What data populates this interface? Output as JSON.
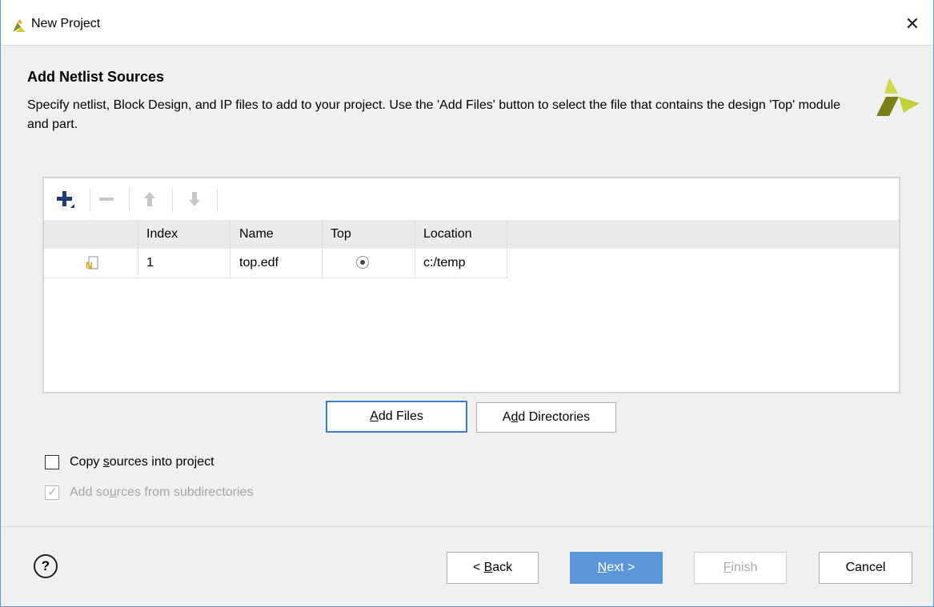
{
  "window": {
    "title": "New Project"
  },
  "page": {
    "title": "Add Netlist Sources",
    "description": "Specify netlist, Block Design, and IP files to add to your project. Use the 'Add Files' button to select the file that contains the design 'Top' module and part."
  },
  "toolbar": {
    "add": "add-icon",
    "remove": "remove-icon",
    "up": "move-up-icon",
    "down": "move-down-icon"
  },
  "table": {
    "columns": [
      "",
      "Index",
      "Name",
      "Top",
      "Location"
    ],
    "rows": [
      {
        "icon": "netlist-file-icon",
        "index": "1",
        "name": "top.edf",
        "top": "selected",
        "location": "c:/temp"
      }
    ]
  },
  "buttons": {
    "add_files": "Add Files",
    "add_directories": "Add Directories",
    "back": "< Back",
    "next": "Next >",
    "finish": "Finish",
    "cancel": "Cancel",
    "help": "?"
  },
  "options": {
    "copy_sources": {
      "label": "Copy sources into project",
      "checked": false
    },
    "add_subdirs": {
      "label": "Add sources from subdirectories",
      "checked": true,
      "disabled": true
    }
  },
  "colors": {
    "accent": "#5a96d8",
    "logo_dark": "#6b7a1a",
    "logo_light": "#c9d24e"
  }
}
